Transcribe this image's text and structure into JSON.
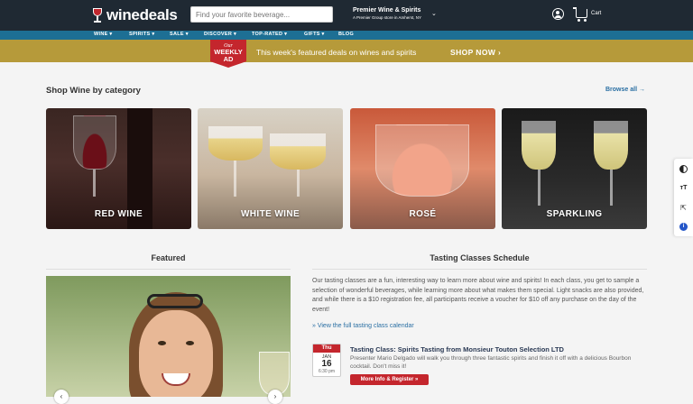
{
  "header": {
    "logo_text": "winedeals",
    "search_placeholder": "Find your favorite beverage...",
    "store_name": "Premier Wine & Spirits",
    "store_subtitle": "A Premier Group store in Amherst, NY",
    "cart_label": "Cart"
  },
  "nav": {
    "items": [
      {
        "label": "WINE ▾"
      },
      {
        "label": "SPIRITS ▾"
      },
      {
        "label": "SALE ▾"
      },
      {
        "label": "DISCOVER ▾"
      },
      {
        "label": "TOP-RATED ▾"
      },
      {
        "label": "GIFTS ▾"
      },
      {
        "label": "BLOG"
      }
    ]
  },
  "banner": {
    "badge_small": "Our",
    "badge_big": "WEEKLY AD",
    "text": "This week's featured deals on wines and spirits",
    "cta": "SHOP NOW ›"
  },
  "categories_section": {
    "title": "Shop Wine by category",
    "browse_all": "Browse all →",
    "items": [
      {
        "label": "RED WINE"
      },
      {
        "label": "WHITE WINE"
      },
      {
        "label": "ROSÉ"
      },
      {
        "label": "SPARKLING"
      }
    ]
  },
  "featured": {
    "title": "Featured"
  },
  "tasting": {
    "title": "Tasting Classes Schedule",
    "description": "Our tasting classes are a fun, interesting way to learn more about wine and spirits! In each class, you get to sample a selection of wonderful beverages, while learning more about what makes them special. Light snacks are also provided, and while there is a $10 registration fee, all participants receive a voucher for $10 off any purchase on the day of the event!",
    "calendar_link": "» View the full tasting class calendar",
    "event": {
      "day": "Thu",
      "month": "JAN",
      "date": "16",
      "time": "6:30 pm",
      "title": "Tasting Class: Spirits Tasting from Monsieur Touton Selection LTD",
      "description": "Presenter Mario Delgado will walk you through three fantastic spirits and finish it off with a delicious Bourbon cocktail. Don't miss it!",
      "button": "More Info & Register »"
    }
  },
  "accessibility_tools": [
    "contrast-icon",
    "text-size-icon",
    "cursor-icon",
    "info-icon"
  ],
  "colors": {
    "topbar": "#1f2933",
    "nav": "#1d6f94",
    "banner": "#b69a3a",
    "accent_red": "#c4262d",
    "link_blue": "#2a6fa3"
  }
}
